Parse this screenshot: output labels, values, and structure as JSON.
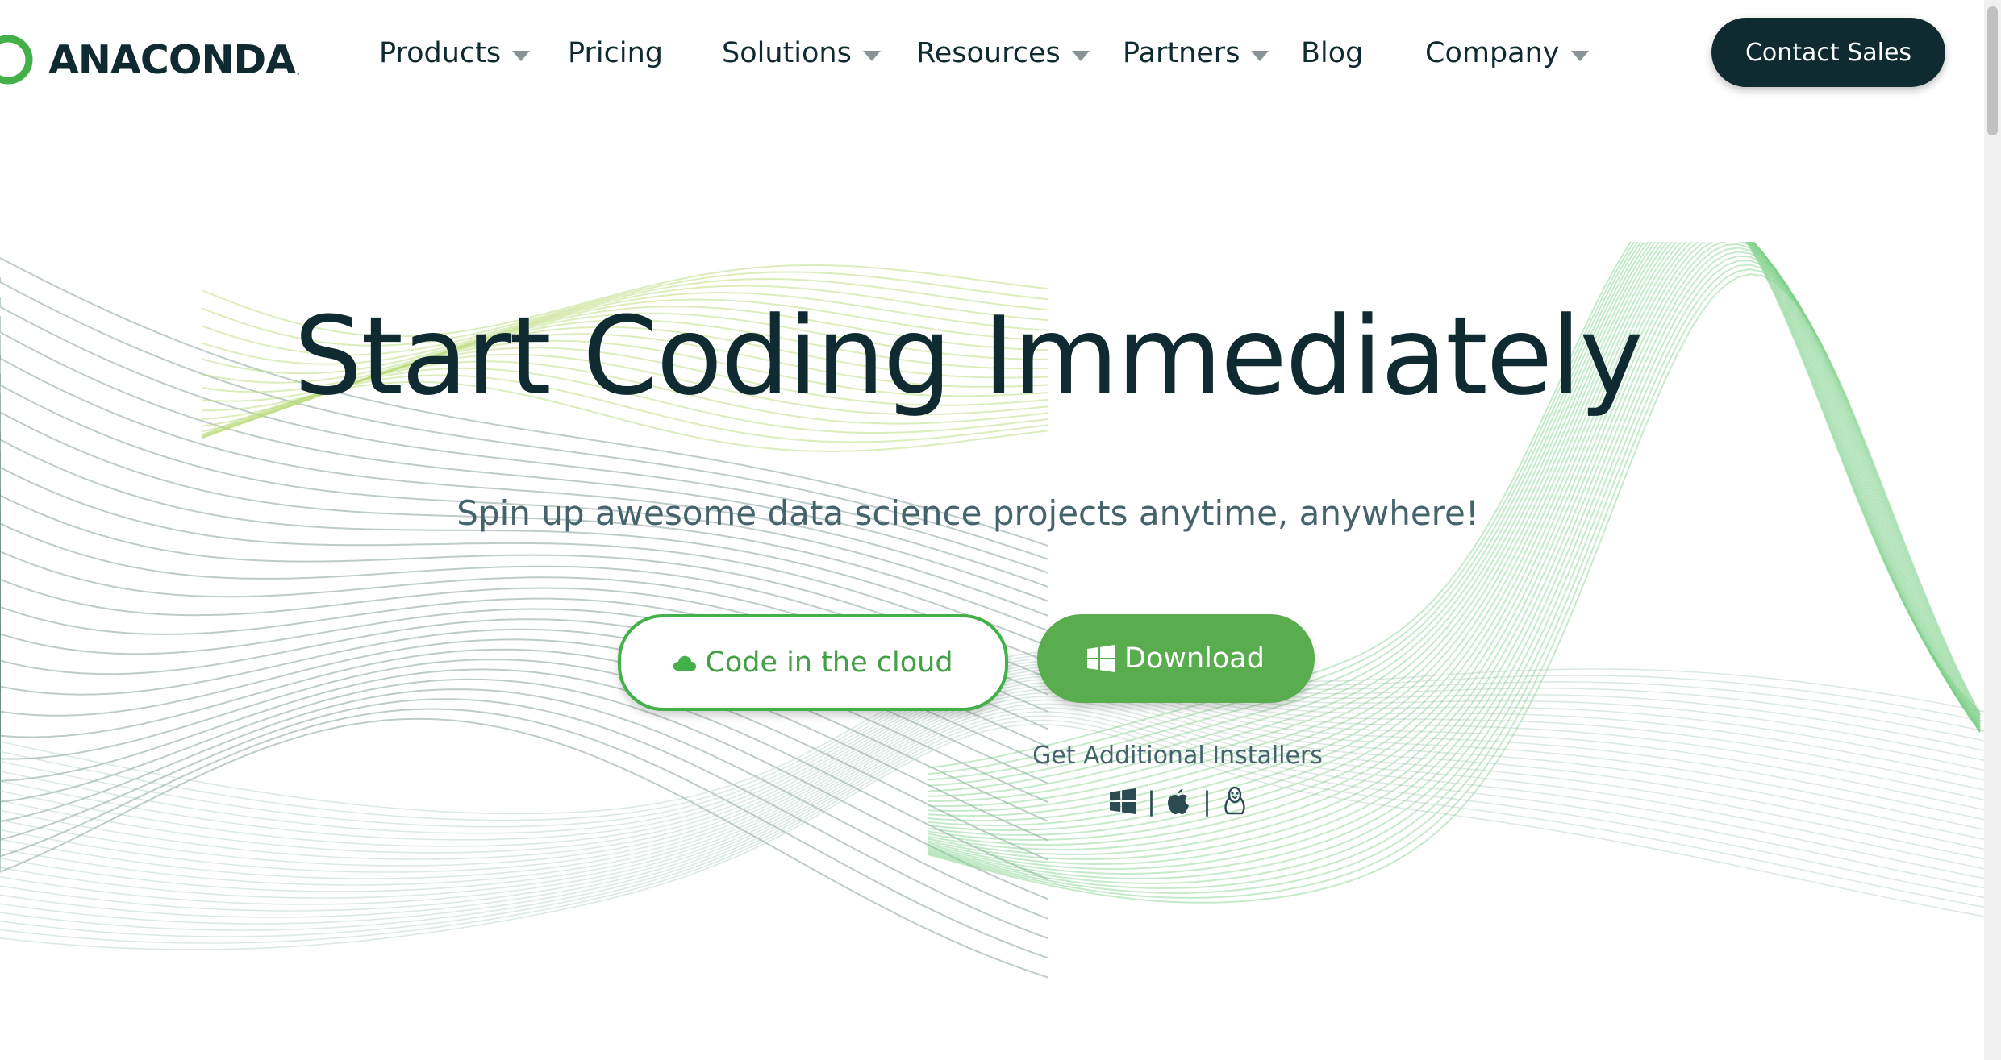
{
  "brand": {
    "name": "ANACONDA",
    "dot": ".",
    "colors": {
      "ink": "#0f2a30",
      "green": "#43b049",
      "download_green": "#5aad4f"
    }
  },
  "nav": {
    "items": [
      {
        "label": "Products",
        "dropdown": true
      },
      {
        "label": "Pricing",
        "dropdown": false
      },
      {
        "label": "Solutions",
        "dropdown": true
      },
      {
        "label": "Resources",
        "dropdown": true
      },
      {
        "label": "Partners",
        "dropdown": true
      },
      {
        "label": "Blog",
        "dropdown": false
      },
      {
        "label": "Company",
        "dropdown": true
      }
    ],
    "contact_label": "Contact Sales"
  },
  "hero": {
    "title": "Start Coding Immediately",
    "subtitle": "Spin up awesome data science projects anytime, anywhere!",
    "cloud_button": {
      "label": "Code in the cloud",
      "icon": "cloud-icon"
    },
    "download_button": {
      "label": "Download",
      "icon": "windows-icon"
    },
    "installers_label": "Get Additional Installers",
    "installers": [
      {
        "os": "Windows",
        "icon": "windows-icon"
      },
      {
        "os": "macOS",
        "icon": "apple-icon"
      },
      {
        "os": "Linux",
        "icon": "linux-icon"
      }
    ],
    "separator": "|"
  }
}
